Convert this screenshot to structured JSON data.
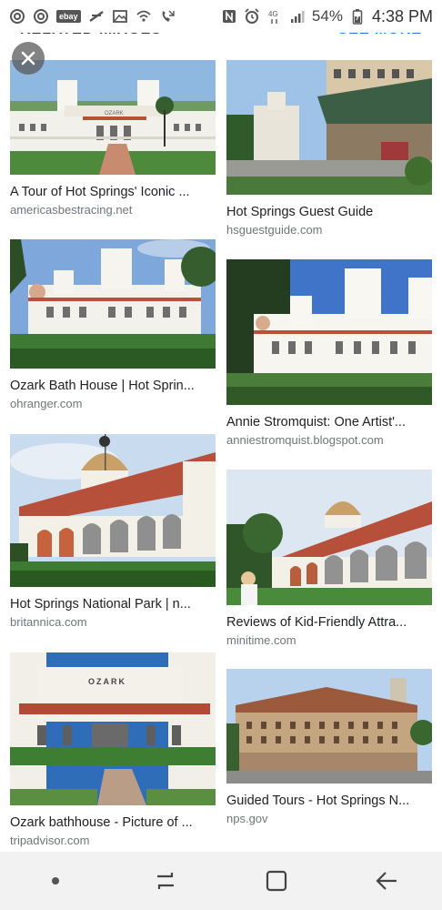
{
  "status_bar": {
    "battery": "54%",
    "time": "4:38 PM",
    "left_icons": [
      "sync-icon",
      "sync-icon",
      "ebay-icon",
      "navigation-icon",
      "image-icon",
      "wifi-call-icon",
      "missed-call-icon"
    ],
    "right_icons": [
      "nfc-icon",
      "alarm-icon",
      "4g-icon",
      "signal-icon",
      "battery-icon"
    ]
  },
  "header": {
    "title": "RELATED IMAGES",
    "see_more": "SEE MORE"
  },
  "results": [
    {
      "title": "A Tour of Hot Springs' Iconic ...",
      "source": "americasbestracing.net"
    },
    {
      "title": "Hot Springs Guest Guide",
      "source": "hsguestguide.com"
    },
    {
      "title": "Ozark Bath House | Hot Sprin...",
      "source": "ohranger.com"
    },
    {
      "title": "Annie Stromquist: One Artist'...",
      "source": "anniestromquist.blogspot.com"
    },
    {
      "title": "Hot Springs National Park | n...",
      "source": "britannica.com"
    },
    {
      "title": "Reviews of Kid-Friendly Attra...",
      "source": "minitime.com"
    },
    {
      "title": "Ozark bathhouse - Picture of ...",
      "source": "tripadvisor.com"
    },
    {
      "title": "Guided Tours - Hot Springs N...",
      "source": "nps.gov"
    }
  ],
  "thumb_images": {
    "r0": {
      "text": "OZARK"
    },
    "r6": {
      "text": "OZARK"
    }
  },
  "colors": {
    "link_blue": "#1a73e8",
    "nav_bg": "#f2f2f2",
    "source_gray": "#70757a"
  }
}
